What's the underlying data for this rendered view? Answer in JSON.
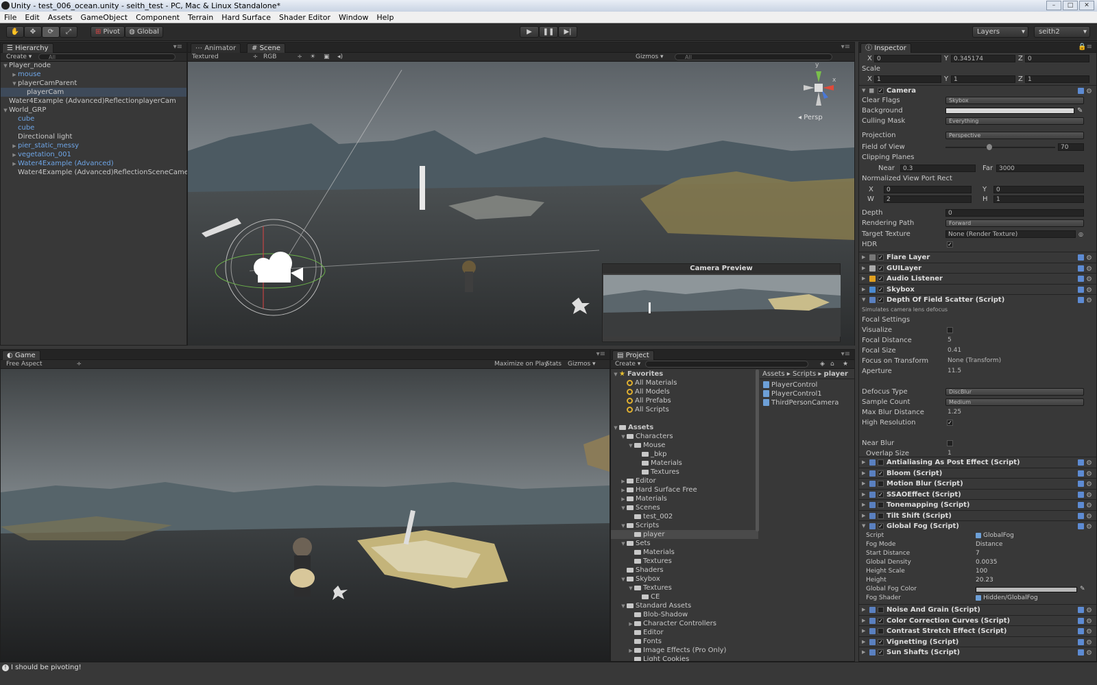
{
  "window": {
    "title": "Unity - test_006_ocean.unity - seith_test - PC, Mac & Linux Standalone*"
  },
  "menu": [
    "File",
    "Edit",
    "Assets",
    "GameObject",
    "Component",
    "Terrain",
    "Hard Surface",
    "Shader Editor",
    "Window",
    "Help"
  ],
  "toolbar": {
    "pivot": "Pivot",
    "global": "Global",
    "layers": "Layers",
    "layout": "seith2"
  },
  "hierarchy": {
    "tab": "Hierarchy",
    "create": "Create",
    "search": "All",
    "items": [
      {
        "label": "Player_node",
        "indent": 0,
        "arrow": "▼",
        "blue": false,
        "sel": false
      },
      {
        "label": "mouse",
        "indent": 1,
        "arrow": "▶",
        "blue": true,
        "sel": false
      },
      {
        "label": "playerCamParent",
        "indent": 1,
        "arrow": "▼",
        "blue": false,
        "sel": false
      },
      {
        "label": "playerCam",
        "indent": 2,
        "arrow": "",
        "blue": false,
        "sel": true
      },
      {
        "label": "Water4Example (Advanced)ReflectionplayerCam",
        "indent": 0,
        "arrow": "",
        "blue": false,
        "sel": false
      },
      {
        "label": "World_GRP",
        "indent": 0,
        "arrow": "▼",
        "blue": false,
        "sel": false
      },
      {
        "label": "cube",
        "indent": 1,
        "arrow": "",
        "blue": true,
        "sel": false
      },
      {
        "label": "cube",
        "indent": 1,
        "arrow": "",
        "blue": true,
        "sel": false
      },
      {
        "label": "Directional light",
        "indent": 1,
        "arrow": "",
        "blue": false,
        "sel": false
      },
      {
        "label": "pier_static_messy",
        "indent": 1,
        "arrow": "▶",
        "blue": true,
        "sel": false
      },
      {
        "label": "vegetation_001",
        "indent": 1,
        "arrow": "▶",
        "blue": true,
        "sel": false
      },
      {
        "label": "Water4Example (Advanced)",
        "indent": 1,
        "arrow": "▶",
        "blue": true,
        "sel": false
      },
      {
        "label": "Water4Example (Advanced)ReflectionSceneCamera",
        "indent": 1,
        "arrow": "",
        "blue": false,
        "sel": false
      }
    ]
  },
  "scene": {
    "tab_animator": "Animator",
    "tab_scene": "Scene",
    "shading": "Textured",
    "rgb": "RGB",
    "gizmos": "Gizmos",
    "search": "All",
    "persp": "Persp",
    "preview": "Camera Preview",
    "gizmo_y": "y",
    "gizmo_x": "x"
  },
  "game": {
    "tab": "Game",
    "aspect": "Free Aspect",
    "maximize": "Maximize on Play",
    "stats": "Stats",
    "gizmos": "Gizmos"
  },
  "project": {
    "tab": "Project",
    "create": "Create",
    "breadcrumb": [
      "Assets",
      "Scripts",
      "player"
    ],
    "files": [
      "PlayerControl",
      "PlayerControl1",
      "ThirdPersonCamera"
    ],
    "tree": [
      {
        "label": "Favorites",
        "indent": 0,
        "kind": "star",
        "arrow": "▼",
        "sel": false
      },
      {
        "label": "All Materials",
        "indent": 1,
        "kind": "search",
        "arrow": "",
        "sel": false
      },
      {
        "label": "All Models",
        "indent": 1,
        "kind": "search",
        "arrow": "",
        "sel": false
      },
      {
        "label": "All Prefabs",
        "indent": 1,
        "kind": "search",
        "arrow": "",
        "sel": false
      },
      {
        "label": "All Scripts",
        "indent": 1,
        "kind": "search",
        "arrow": "",
        "sel": false
      },
      {
        "label": "",
        "indent": 0,
        "kind": "none",
        "arrow": "",
        "sel": false
      },
      {
        "label": "Assets",
        "indent": 0,
        "kind": "folder",
        "arrow": "▼",
        "sel": false
      },
      {
        "label": "Characters",
        "indent": 1,
        "kind": "folder",
        "arrow": "▼",
        "sel": false
      },
      {
        "label": "Mouse",
        "indent": 2,
        "kind": "folder",
        "arrow": "▼",
        "sel": false
      },
      {
        "label": "_bkp",
        "indent": 3,
        "kind": "folder",
        "arrow": "",
        "sel": false
      },
      {
        "label": "Materials",
        "indent": 3,
        "kind": "folder",
        "arrow": "",
        "sel": false
      },
      {
        "label": "Textures",
        "indent": 3,
        "kind": "folder",
        "arrow": "",
        "sel": false
      },
      {
        "label": "Editor",
        "indent": 1,
        "kind": "folder",
        "arrow": "▶",
        "sel": false
      },
      {
        "label": "Hard Surface Free",
        "indent": 1,
        "kind": "folder",
        "arrow": "▶",
        "sel": false
      },
      {
        "label": "Materials",
        "indent": 1,
        "kind": "folder",
        "arrow": "▶",
        "sel": false
      },
      {
        "label": "Scenes",
        "indent": 1,
        "kind": "folder",
        "arrow": "▼",
        "sel": false
      },
      {
        "label": "test_002",
        "indent": 2,
        "kind": "folder",
        "arrow": "",
        "sel": false
      },
      {
        "label": "Scripts",
        "indent": 1,
        "kind": "folder",
        "arrow": "▼",
        "sel": false
      },
      {
        "label": "player",
        "indent": 2,
        "kind": "folder",
        "arrow": "",
        "sel": true
      },
      {
        "label": "Sets",
        "indent": 1,
        "kind": "folder",
        "arrow": "▼",
        "sel": false
      },
      {
        "label": "Materials",
        "indent": 2,
        "kind": "folder",
        "arrow": "",
        "sel": false
      },
      {
        "label": "Textures",
        "indent": 2,
        "kind": "folder",
        "arrow": "",
        "sel": false
      },
      {
        "label": "Shaders",
        "indent": 1,
        "kind": "folder",
        "arrow": "",
        "sel": false
      },
      {
        "label": "Skybox",
        "indent": 1,
        "kind": "folder",
        "arrow": "▼",
        "sel": false
      },
      {
        "label": "Textures",
        "indent": 2,
        "kind": "folder",
        "arrow": "▼",
        "sel": false
      },
      {
        "label": "CE",
        "indent": 3,
        "kind": "folder",
        "arrow": "",
        "sel": false
      },
      {
        "label": "Standard Assets",
        "indent": 1,
        "kind": "folder",
        "arrow": "▼",
        "sel": false
      },
      {
        "label": "Blob-Shadow",
        "indent": 2,
        "kind": "folder",
        "arrow": "",
        "sel": false
      },
      {
        "label": "Character Controllers",
        "indent": 2,
        "kind": "folder",
        "arrow": "▶",
        "sel": false
      },
      {
        "label": "Editor",
        "indent": 2,
        "kind": "folder",
        "arrow": "",
        "sel": false
      },
      {
        "label": "Fonts",
        "indent": 2,
        "kind": "folder",
        "arrow": "",
        "sel": false
      },
      {
        "label": "Image Effects (Pro Only)",
        "indent": 2,
        "kind": "folder",
        "arrow": "▶",
        "sel": false
      },
      {
        "label": "Light Cookies",
        "indent": 2,
        "kind": "folder",
        "arrow": "",
        "sel": false
      }
    ]
  },
  "inspector": {
    "tab": "Inspector",
    "pos": {
      "x": "0",
      "y": "0.345174",
      "z": "0"
    },
    "scale_label": "Scale",
    "scale": {
      "x": "1",
      "y": "1",
      "z": "1"
    },
    "camera": {
      "title": "Camera",
      "clear_flags_label": "Clear Flags",
      "clear_flags": "Skybox",
      "background_label": "Background",
      "culling_label": "Culling Mask",
      "culling": "Everything",
      "projection_label": "Projection",
      "projection": "Perspective",
      "fov_label": "Field of View",
      "fov": "70",
      "clipping_label": "Clipping Planes",
      "near_label": "Near",
      "near": "0.3",
      "far_label": "Far",
      "far": "3000",
      "viewport_label": "Normalized View Port Rect",
      "vx": "0",
      "vy": "0",
      "vw": "2",
      "vh": "1",
      "depth_label": "Depth",
      "depth": "0",
      "render_path_label": "Rendering Path",
      "render_path": "Forward",
      "target_label": "Target Texture",
      "target": "None (Render Texture)",
      "hdr_label": "HDR"
    },
    "components": [
      "Flare Layer",
      "GUILayer",
      "Audio Listener",
      "Skybox"
    ],
    "dof": {
      "title": "Depth Of Field Scatter (Script)",
      "desc": "Simulates camera lens defocus",
      "focal_settings": "Focal Settings",
      "rows": [
        {
          "label": "Visualize",
          "value": "",
          "kind": "chk-off"
        },
        {
          "label": "Focal Distance",
          "value": "5",
          "kind": "text"
        },
        {
          "label": "Focal Size",
          "value": "0.41",
          "kind": "text"
        },
        {
          "label": "Focus on Transform",
          "value": "None (Transform)",
          "kind": "obj"
        },
        {
          "label": "Aperture",
          "value": "11.5",
          "kind": "text"
        },
        {
          "label": "",
          "value": "",
          "kind": "gap"
        },
        {
          "label": "Defocus Type",
          "value": "DiscBlur",
          "kind": "dd"
        },
        {
          "label": "Sample Count",
          "value": "Medium",
          "kind": "dd"
        },
        {
          "label": "Max Blur Distance",
          "value": "1.25",
          "kind": "text"
        },
        {
          "label": "High Resolution",
          "value": "",
          "kind": "chk-on"
        },
        {
          "label": "",
          "value": "",
          "kind": "gap"
        },
        {
          "label": "Near Blur",
          "value": "",
          "kind": "chk-off"
        },
        {
          "label": "Overlap Size",
          "value": "1",
          "kind": "text"
        }
      ]
    },
    "scripts_a": [
      {
        "label": "Antialiasing As Post Effect (Script)",
        "on": false
      },
      {
        "label": "Bloom (Script)",
        "on": true
      },
      {
        "label": "Motion Blur (Script)",
        "on": false
      },
      {
        "label": "SSAOEffect (Script)",
        "on": true
      },
      {
        "label": "Tonemapping (Script)",
        "on": false
      },
      {
        "label": "Tilt Shift (Script)",
        "on": false
      }
    ],
    "fog": {
      "title": "Global Fog (Script)",
      "rows": [
        {
          "label": "Script",
          "value": "GlobalFog"
        },
        {
          "label": "Fog Mode",
          "value": "Distance"
        },
        {
          "label": "Start Distance",
          "value": "7"
        },
        {
          "label": "Global Density",
          "value": "0.0035"
        },
        {
          "label": "Height Scale",
          "value": "100"
        },
        {
          "label": "Height",
          "value": "20.23"
        },
        {
          "label": "Global Fog Color",
          "value": ""
        },
        {
          "label": "Fog Shader",
          "value": "Hidden/GlobalFog"
        }
      ]
    },
    "scripts_b": [
      {
        "label": "Noise And Grain (Script)",
        "on": false
      },
      {
        "label": "Color Correction Curves (Script)",
        "on": true
      },
      {
        "label": "Contrast Stretch Effect (Script)",
        "on": false
      },
      {
        "label": "Vignetting (Script)",
        "on": true
      },
      {
        "label": "Sun Shafts (Script)",
        "on": true
      }
    ]
  },
  "status": {
    "message": "I should be pivoting!"
  },
  "colors": {
    "accent": "#3e5f96",
    "selection": "#3e4a5a",
    "prefab": "#6ea5e6"
  }
}
